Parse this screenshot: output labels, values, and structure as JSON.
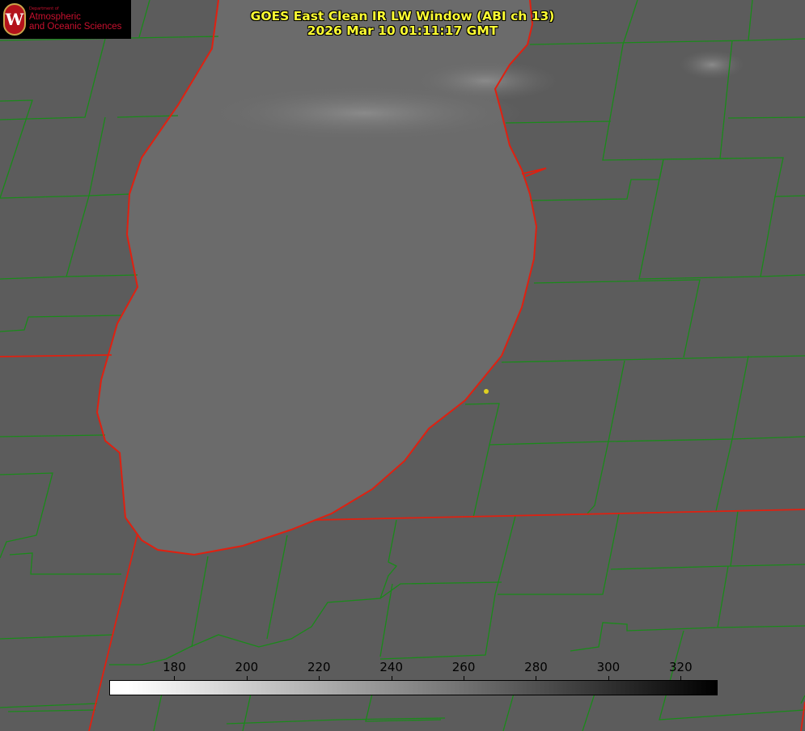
{
  "header": {
    "title_line1": "GOES East Clean IR LW Window (ABI ch 13)",
    "title_line2": "2026 Mar 10 01:11:17 GMT"
  },
  "logo": {
    "seal_letter": "W",
    "dept_small": "Department of",
    "dept_line1": "Atmospheric",
    "dept_line2": "and Oceanic Sciences"
  },
  "colorbar": {
    "min": 162,
    "max": 330,
    "ticks": [
      "180",
      "200",
      "220",
      "240",
      "260",
      "280",
      "300",
      "320"
    ],
    "tick_values": [
      180,
      200,
      220,
      240,
      260,
      280,
      300,
      320
    ]
  },
  "colors": {
    "county_lines": "#1a8a1a",
    "state_lines": "#e02010",
    "marker": "#e0d020",
    "title": "#ffff33"
  }
}
